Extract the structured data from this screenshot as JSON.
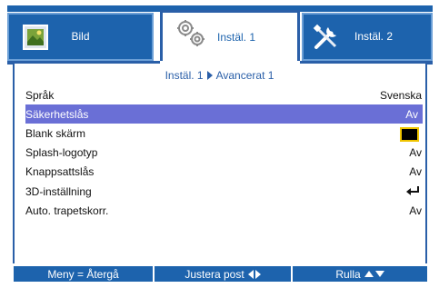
{
  "tabs": [
    {
      "label": "Bild",
      "icon": "picture-icon",
      "active": false
    },
    {
      "label": "Instäl. 1",
      "icon": "gears-icon",
      "active": true
    },
    {
      "label": "Instäl. 2",
      "icon": "tools-icon",
      "active": false
    }
  ],
  "breadcrumb": {
    "parent": "Instäl. 1",
    "child": "Avancerat 1"
  },
  "rows": [
    {
      "label": "Språk",
      "value": "Svenska"
    },
    {
      "label": "Säkerhetslås",
      "value": "Av"
    },
    {
      "label": "Blank skärm",
      "value": ""
    },
    {
      "label": "Splash-logotyp",
      "value": "Av"
    },
    {
      "label": "Knappsattslås",
      "value": "Av"
    },
    {
      "label": "3D-inställning",
      "value": ""
    },
    {
      "label": "Auto. trapetskorr.",
      "value": "Av"
    }
  ],
  "footer": {
    "menu": "Meny = Återgå",
    "adjust": "Justera post",
    "scroll": "Rulla"
  },
  "colors": {
    "accent": "#1d63ad",
    "selected": "#6a6fd6",
    "blank_box": "#000000",
    "blank_border": "#f0c400"
  }
}
